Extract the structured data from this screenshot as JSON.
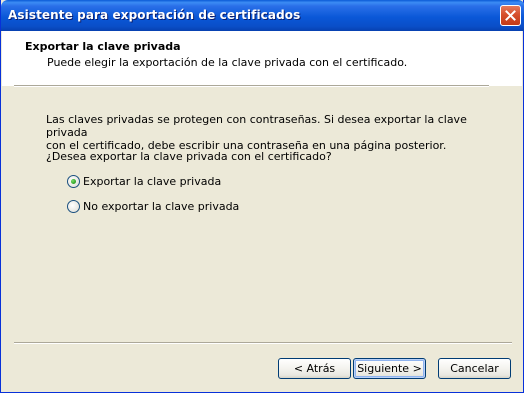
{
  "window": {
    "title": "Asistente para exportación de certificados"
  },
  "header": {
    "title": "Exportar la clave privada",
    "subtitle": "Puede elegir la exportación de la clave privada con el certificado."
  },
  "body": {
    "paragraph_line1": "Las claves privadas se protegen con contraseñas. Si desea exportar la clave privada",
    "paragraph_line2": "con el certificado, debe escribir una contraseña en una página posterior.",
    "question": "¿Desea exportar la clave privada con el certificado?",
    "options": [
      {
        "label": "Exportar la clave privada",
        "selected": true
      },
      {
        "label": "No exportar la clave privada",
        "selected": false
      }
    ]
  },
  "buttons": {
    "back": "< Atrás",
    "next": "Siguiente >",
    "cancel": "Cancelar"
  },
  "icons": {
    "close": "close-icon"
  }
}
